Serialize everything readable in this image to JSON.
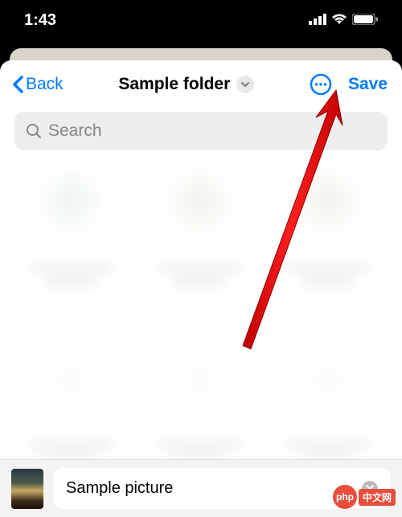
{
  "statusbar": {
    "time": "1:43"
  },
  "nav": {
    "back_label": "Back",
    "title": "Sample folder",
    "save_label": "Save"
  },
  "search": {
    "placeholder": "Search"
  },
  "bottom": {
    "filename": "Sample picture"
  },
  "watermark": {
    "abbr": "php",
    "text": "中文网"
  },
  "colors": {
    "accent": "#007aff",
    "arrow": "#ff0000"
  }
}
